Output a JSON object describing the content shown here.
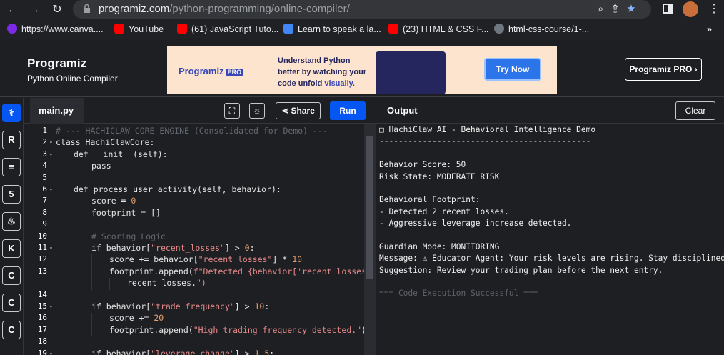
{
  "browser": {
    "url_domain": "programiz.com",
    "url_path": "/python-programming/online-compiler/",
    "bookmarks": [
      "https://www.canva....",
      "YouTube",
      "(61) JavaScript Tuto...",
      "Learn to speak a la...",
      "(23) HTML & CSS F...",
      "html-css-course/1-..."
    ]
  },
  "header": {
    "logo": "Programiz",
    "subtitle": "Python Online Compiler",
    "ad_logo": "Programiz",
    "ad_pro": "PRO",
    "ad_line1": "Understand Python",
    "ad_line2": "better by watching your",
    "ad_line3": "code unfold ",
    "ad_line3_highlight": "visually.",
    "ad_button": "Try Now",
    "pro_button": "Programiz PRO ›"
  },
  "editor": {
    "tab": "main.py",
    "share": "Share",
    "run": "Run",
    "lines": [
      {
        "n": "1",
        "text": "# --- HACHICLAW CORE ENGINE (Consolidated for Demo) ---",
        "type": "cm",
        "indent": 0
      },
      {
        "n": "2",
        "text": "class HachiClawCore:",
        "type": "code",
        "indent": 0
      },
      {
        "n": "3",
        "text": "def __init__(self):",
        "type": "code",
        "indent": 1
      },
      {
        "n": "4",
        "text": "pass",
        "type": "code",
        "indent": 2
      },
      {
        "n": "5",
        "text": "",
        "type": "code",
        "indent": 0
      },
      {
        "n": "6",
        "text": "def process_user_activity(self, behavior):",
        "type": "code",
        "indent": 1
      },
      {
        "n": "7",
        "text": "score = 0",
        "type": "code",
        "indent": 2
      },
      {
        "n": "8",
        "text": "footprint = []",
        "type": "code",
        "indent": 2
      },
      {
        "n": "9",
        "text": "",
        "type": "code",
        "indent": 0
      },
      {
        "n": "10",
        "text": "# Scoring Logic",
        "type": "cm",
        "indent": 2
      },
      {
        "n": "11",
        "text": "if behavior[\"recent_losses\"] > 0:",
        "type": "code",
        "indent": 2
      },
      {
        "n": "12",
        "text": "score += behavior[\"recent_losses\"] * 10",
        "type": "code",
        "indent": 3
      },
      {
        "n": "13",
        "text": "footprint.append(f\"Detected {behavior['recent_losses']}",
        "type": "code",
        "indent": 3
      },
      {
        "n": "",
        "text": "recent losses.\")",
        "type": "code",
        "indent": 4
      },
      {
        "n": "14",
        "text": "",
        "type": "code",
        "indent": 0
      },
      {
        "n": "15",
        "text": "if behavior[\"trade_frequency\"] > 10:",
        "type": "code",
        "indent": 2
      },
      {
        "n": "16",
        "text": "score += 20",
        "type": "code",
        "indent": 3
      },
      {
        "n": "17",
        "text": "footprint.append(\"High trading frequency detected.\")",
        "type": "code",
        "indent": 3
      },
      {
        "n": "18",
        "text": "",
        "type": "code",
        "indent": 0
      },
      {
        "n": "19",
        "text": "if behavior[\"leverage_change\"] > 1.5:",
        "type": "code",
        "indent": 2
      }
    ]
  },
  "output": {
    "title": "Output",
    "clear": "Clear",
    "lines": [
      "□ HachiClaw AI - Behavioral Intelligence Demo",
      "--------------------------------------------",
      "",
      "Behavior Score: 50",
      "Risk State: MODERATE_RISK",
      "",
      "Behavioral Footprint:",
      "- Detected 2 recent losses.",
      "- Aggressive leverage increase detected.",
      "",
      "Guardian Mode: MONITORING",
      "Message: ⚠ Educator Agent: Your risk levels are rising. Stay disciplined.",
      "Suggestion: Review your trading plan before the next entry.",
      "",
      "=== Code Execution Successful ==="
    ]
  }
}
